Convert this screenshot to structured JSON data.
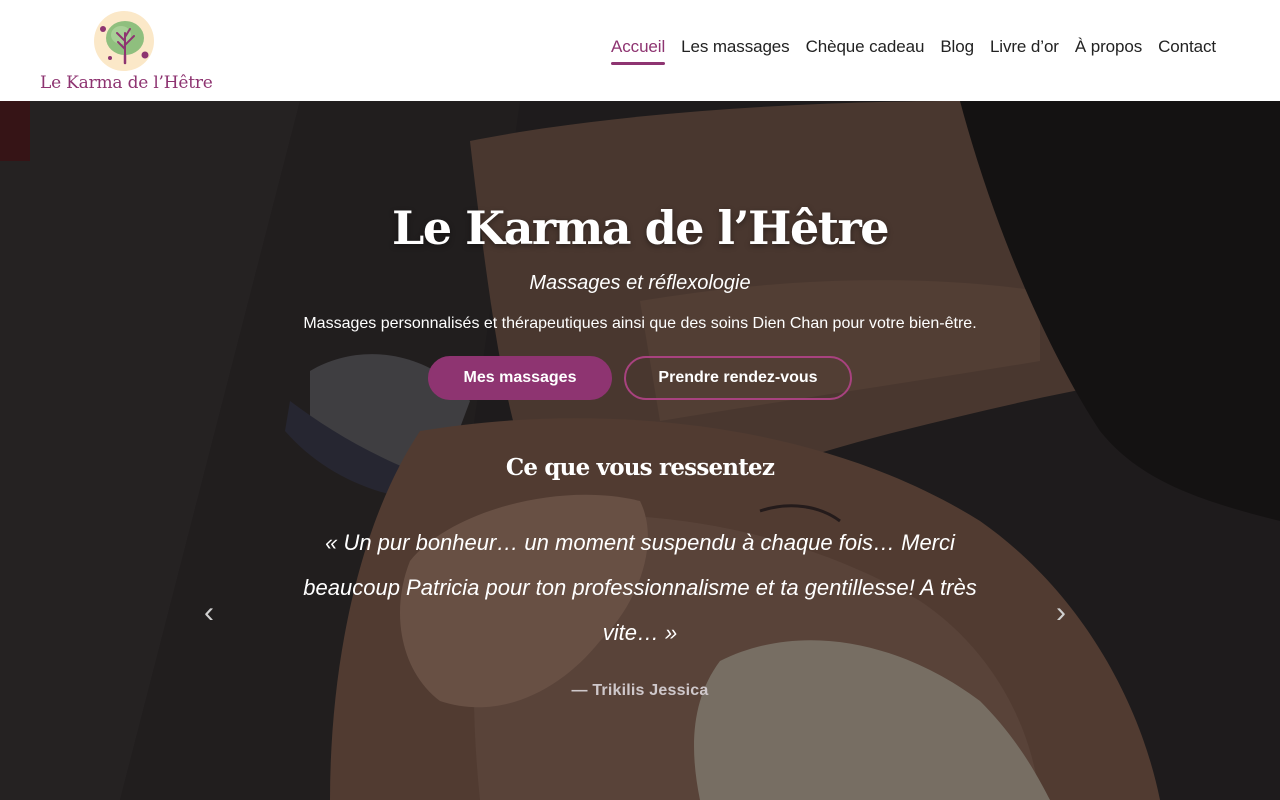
{
  "brand": {
    "name": "Le Karma de l’Hêtre",
    "logo_icon": "beech-tree-icon",
    "accent_color": "#8e3471"
  },
  "nav": {
    "items": [
      {
        "label": "Accueil",
        "active": true
      },
      {
        "label": "Les massages",
        "active": false
      },
      {
        "label": "Chèque cadeau",
        "active": false
      },
      {
        "label": "Blog",
        "active": false
      },
      {
        "label": "Livre d’or",
        "active": false
      },
      {
        "label": "À propos",
        "active": false
      },
      {
        "label": "Contact",
        "active": false
      }
    ]
  },
  "hero": {
    "title": "Le Karma de l’Hêtre",
    "subtitle": "Massages et réflexologie",
    "description": "Massages personnalisés et thérapeutiques ainsi que des soins Dien Chan pour votre bien-être.",
    "primary_button": "Mes massages",
    "secondary_button": "Prendre rendez-vous"
  },
  "testimonials": {
    "section_title": "Ce que vous ressentez",
    "quote": "« Un pur bonheur… un moment suspendu à chaque fois… Merci beaucoup Patricia pour ton professionnalisme et ta gentillesse! A très vite… »",
    "author": "— Trikilis Jessica",
    "prev_icon": "chevron-left-icon",
    "next_icon": "chevron-right-icon",
    "prev_glyph": "‹",
    "next_glyph": "›"
  }
}
